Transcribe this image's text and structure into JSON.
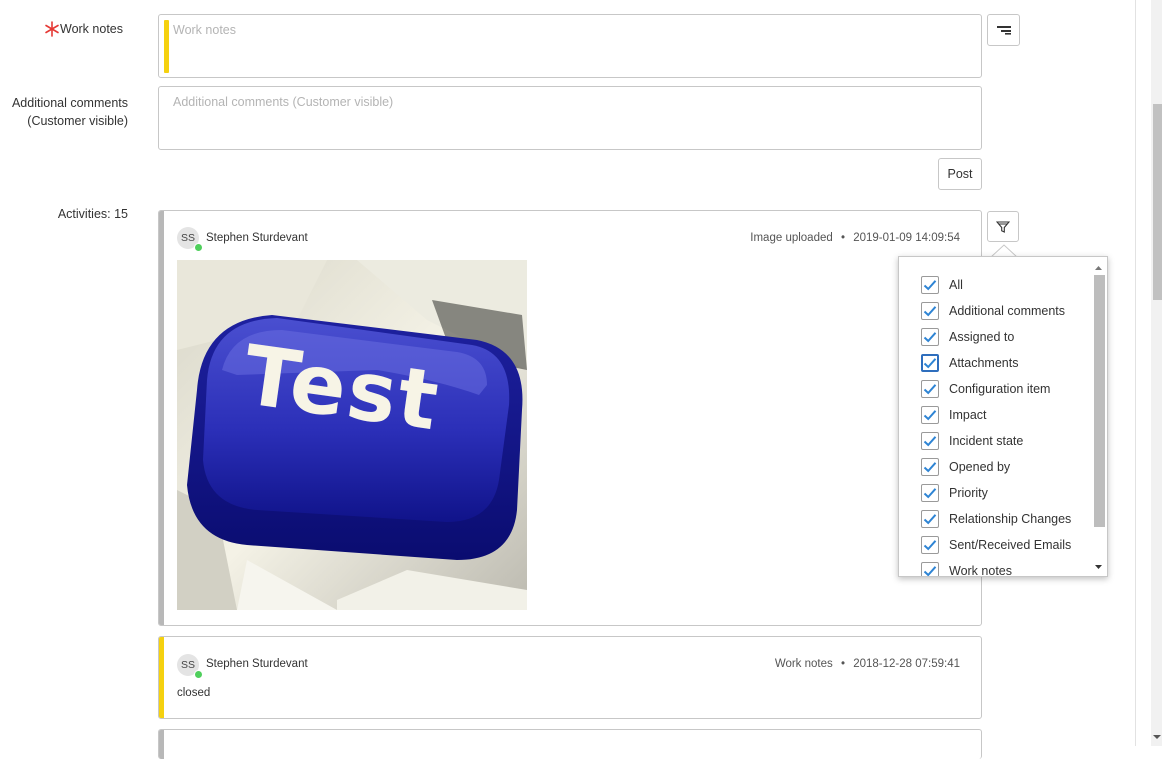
{
  "work_notes": {
    "label": "Work notes",
    "placeholder": "Work notes",
    "accent_color": "#f5d10f",
    "required_color": "#e53935"
  },
  "additional_comments": {
    "label_line1": "Additional comments",
    "label_line2": "(Customer visible)",
    "placeholder": "Additional comments (Customer visible)"
  },
  "post_button": "Post",
  "activities": {
    "label": "Activities: 15",
    "entries": [
      {
        "initials": "SS",
        "author": "Stephen Sturdevant",
        "type": "Image uploaded",
        "timestamp": "2019-01-09 14:09:54",
        "image_text": "Test",
        "accent_color": "#b8b8b8"
      },
      {
        "initials": "SS",
        "author": "Stephen Sturdevant",
        "type": "Work notes",
        "timestamp": "2018-12-28 07:59:41",
        "body": "closed",
        "accent_color": "#f5d10f"
      }
    ]
  },
  "filter_popup": {
    "items": [
      {
        "label": "All",
        "checked": true
      },
      {
        "label": "Additional comments",
        "checked": true
      },
      {
        "label": "Assigned to",
        "checked": true
      },
      {
        "label": "Attachments",
        "checked": true,
        "focused": true
      },
      {
        "label": "Configuration item",
        "checked": true
      },
      {
        "label": "Impact",
        "checked": true
      },
      {
        "label": "Incident state",
        "checked": true
      },
      {
        "label": "Opened by",
        "checked": true
      },
      {
        "label": "Priority",
        "checked": true
      },
      {
        "label": "Relationship Changes",
        "checked": true
      },
      {
        "label": "Sent/Received Emails",
        "checked": true
      },
      {
        "label": "Work notes",
        "checked": true
      }
    ],
    "check_color": "#2e84d4"
  },
  "icons": {
    "required": "asterisk-icon",
    "toggle": "stack-toggle-icon",
    "filter": "funnel-icon",
    "check": "checkmark-icon"
  }
}
